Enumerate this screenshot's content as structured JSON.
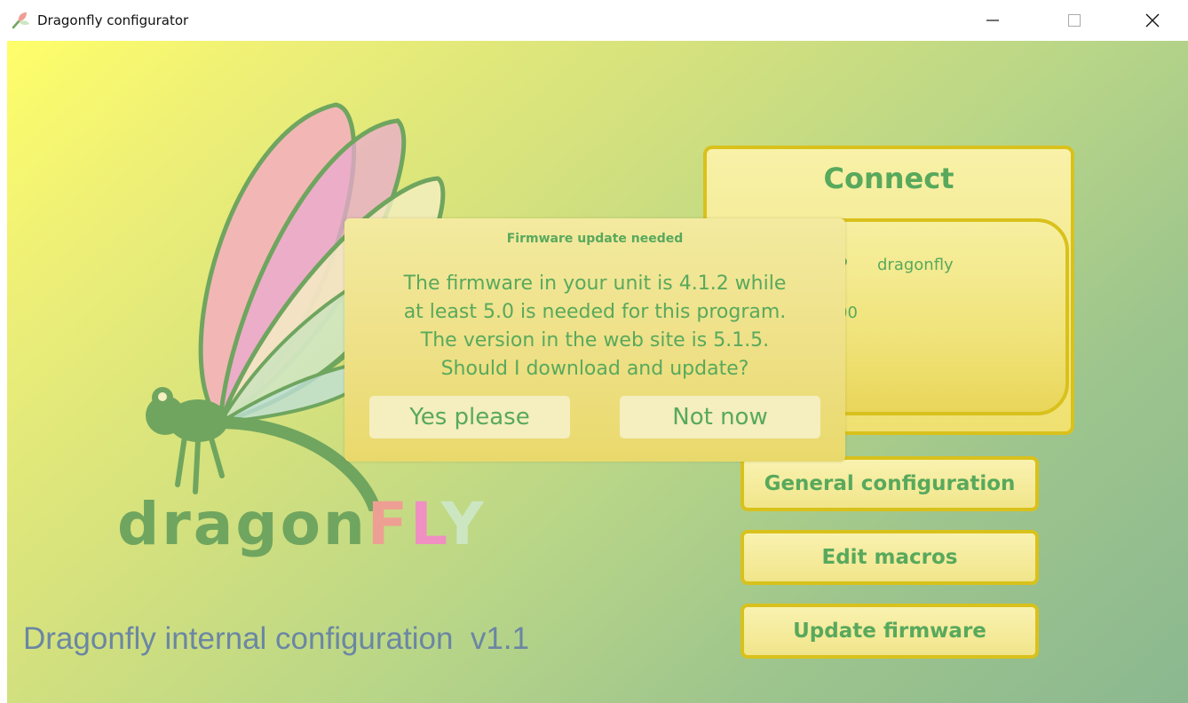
{
  "window": {
    "title": "Dragonfly configurator",
    "minimize": "—",
    "maximize": "☐",
    "close": "✕"
  },
  "brand": {
    "part1": "dragon",
    "part2": "F",
    "part3": "L",
    "part4": "Y",
    "subtitle": "Dragonfly internal configuration  v1.1"
  },
  "connect": {
    "title": "Connect",
    "label_partial": "P",
    "device_name": "dragonfly",
    "port_partial": "00"
  },
  "buttons": {
    "general": "General configuration",
    "macros": "Edit macros",
    "firmware": "Update firmware"
  },
  "dialog": {
    "title": "Firmware update needed",
    "lines": [
      "The firmware in your unit is 4.1.2 while",
      "at least 5.0 is needed for this program.",
      "The version in the web site is 5.1.5.",
      "Should I download and update?"
    ],
    "yes": "Yes please",
    "no": "Not now"
  },
  "colors": {
    "accent_green": "#58a95c",
    "border_gold": "#d9c11c",
    "logo_green": "#6fa55f"
  },
  "icons": [
    "dragonfly-app-icon"
  ]
}
